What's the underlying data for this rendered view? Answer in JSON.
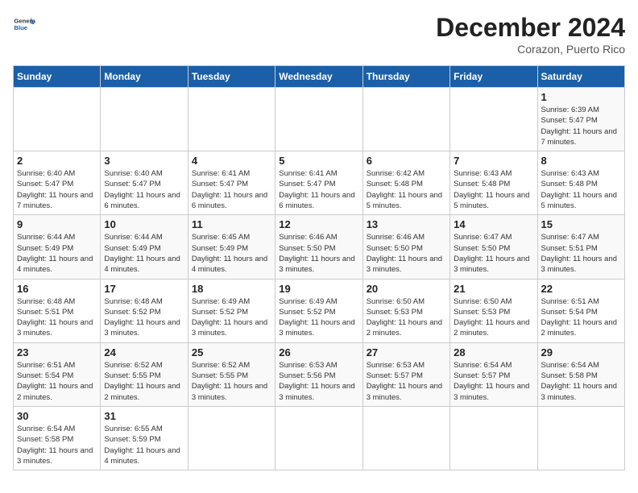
{
  "header": {
    "logo_general": "General",
    "logo_blue": "Blue",
    "month": "December 2024",
    "location": "Corazon, Puerto Rico"
  },
  "weekdays": [
    "Sunday",
    "Monday",
    "Tuesday",
    "Wednesday",
    "Thursday",
    "Friday",
    "Saturday"
  ],
  "days": [
    {
      "num": "",
      "info": ""
    },
    {
      "num": "",
      "info": ""
    },
    {
      "num": "",
      "info": ""
    },
    {
      "num": "",
      "info": ""
    },
    {
      "num": "",
      "info": ""
    },
    {
      "num": "",
      "info": ""
    },
    {
      "num": "1",
      "info": "Sunrise: 6:39 AM\nSunset: 5:47 PM\nDaylight: 11 hours and 7 minutes."
    },
    {
      "num": "2",
      "info": "Sunrise: 6:40 AM\nSunset: 5:47 PM\nDaylight: 11 hours and 7 minutes."
    },
    {
      "num": "3",
      "info": "Sunrise: 6:40 AM\nSunset: 5:47 PM\nDaylight: 11 hours and 6 minutes."
    },
    {
      "num": "4",
      "info": "Sunrise: 6:41 AM\nSunset: 5:47 PM\nDaylight: 11 hours and 6 minutes."
    },
    {
      "num": "5",
      "info": "Sunrise: 6:41 AM\nSunset: 5:47 PM\nDaylight: 11 hours and 6 minutes."
    },
    {
      "num": "6",
      "info": "Sunrise: 6:42 AM\nSunset: 5:48 PM\nDaylight: 11 hours and 5 minutes."
    },
    {
      "num": "7",
      "info": "Sunrise: 6:43 AM\nSunset: 5:48 PM\nDaylight: 11 hours and 5 minutes."
    },
    {
      "num": "8",
      "info": "Sunrise: 6:43 AM\nSunset: 5:48 PM\nDaylight: 11 hours and 5 minutes."
    },
    {
      "num": "9",
      "info": "Sunrise: 6:44 AM\nSunset: 5:49 PM\nDaylight: 11 hours and 4 minutes."
    },
    {
      "num": "10",
      "info": "Sunrise: 6:44 AM\nSunset: 5:49 PM\nDaylight: 11 hours and 4 minutes."
    },
    {
      "num": "11",
      "info": "Sunrise: 6:45 AM\nSunset: 5:49 PM\nDaylight: 11 hours and 4 minutes."
    },
    {
      "num": "12",
      "info": "Sunrise: 6:46 AM\nSunset: 5:50 PM\nDaylight: 11 hours and 3 minutes."
    },
    {
      "num": "13",
      "info": "Sunrise: 6:46 AM\nSunset: 5:50 PM\nDaylight: 11 hours and 3 minutes."
    },
    {
      "num": "14",
      "info": "Sunrise: 6:47 AM\nSunset: 5:50 PM\nDaylight: 11 hours and 3 minutes."
    },
    {
      "num": "15",
      "info": "Sunrise: 6:47 AM\nSunset: 5:51 PM\nDaylight: 11 hours and 3 minutes."
    },
    {
      "num": "16",
      "info": "Sunrise: 6:48 AM\nSunset: 5:51 PM\nDaylight: 11 hours and 3 minutes."
    },
    {
      "num": "17",
      "info": "Sunrise: 6:48 AM\nSunset: 5:52 PM\nDaylight: 11 hours and 3 minutes."
    },
    {
      "num": "18",
      "info": "Sunrise: 6:49 AM\nSunset: 5:52 PM\nDaylight: 11 hours and 3 minutes."
    },
    {
      "num": "19",
      "info": "Sunrise: 6:49 AM\nSunset: 5:52 PM\nDaylight: 11 hours and 3 minutes."
    },
    {
      "num": "20",
      "info": "Sunrise: 6:50 AM\nSunset: 5:53 PM\nDaylight: 11 hours and 2 minutes."
    },
    {
      "num": "21",
      "info": "Sunrise: 6:50 AM\nSunset: 5:53 PM\nDaylight: 11 hours and 2 minutes."
    },
    {
      "num": "22",
      "info": "Sunrise: 6:51 AM\nSunset: 5:54 PM\nDaylight: 11 hours and 2 minutes."
    },
    {
      "num": "23",
      "info": "Sunrise: 6:51 AM\nSunset: 5:54 PM\nDaylight: 11 hours and 2 minutes."
    },
    {
      "num": "24",
      "info": "Sunrise: 6:52 AM\nSunset: 5:55 PM\nDaylight: 11 hours and 2 minutes."
    },
    {
      "num": "25",
      "info": "Sunrise: 6:52 AM\nSunset: 5:55 PM\nDaylight: 11 hours and 3 minutes."
    },
    {
      "num": "26",
      "info": "Sunrise: 6:53 AM\nSunset: 5:56 PM\nDaylight: 11 hours and 3 minutes."
    },
    {
      "num": "27",
      "info": "Sunrise: 6:53 AM\nSunset: 5:57 PM\nDaylight: 11 hours and 3 minutes."
    },
    {
      "num": "28",
      "info": "Sunrise: 6:54 AM\nSunset: 5:57 PM\nDaylight: 11 hours and 3 minutes."
    },
    {
      "num": "29",
      "info": "Sunrise: 6:54 AM\nSunset: 5:58 PM\nDaylight: 11 hours and 3 minutes."
    },
    {
      "num": "30",
      "info": "Sunrise: 6:54 AM\nSunset: 5:58 PM\nDaylight: 11 hours and 3 minutes."
    },
    {
      "num": "31",
      "info": "Sunrise: 6:55 AM\nSunset: 5:59 PM\nDaylight: 11 hours and 4 minutes."
    },
    {
      "num": "",
      "info": ""
    },
    {
      "num": "",
      "info": ""
    },
    {
      "num": "",
      "info": ""
    },
    {
      "num": "",
      "info": ""
    },
    {
      "num": "",
      "info": ""
    }
  ]
}
